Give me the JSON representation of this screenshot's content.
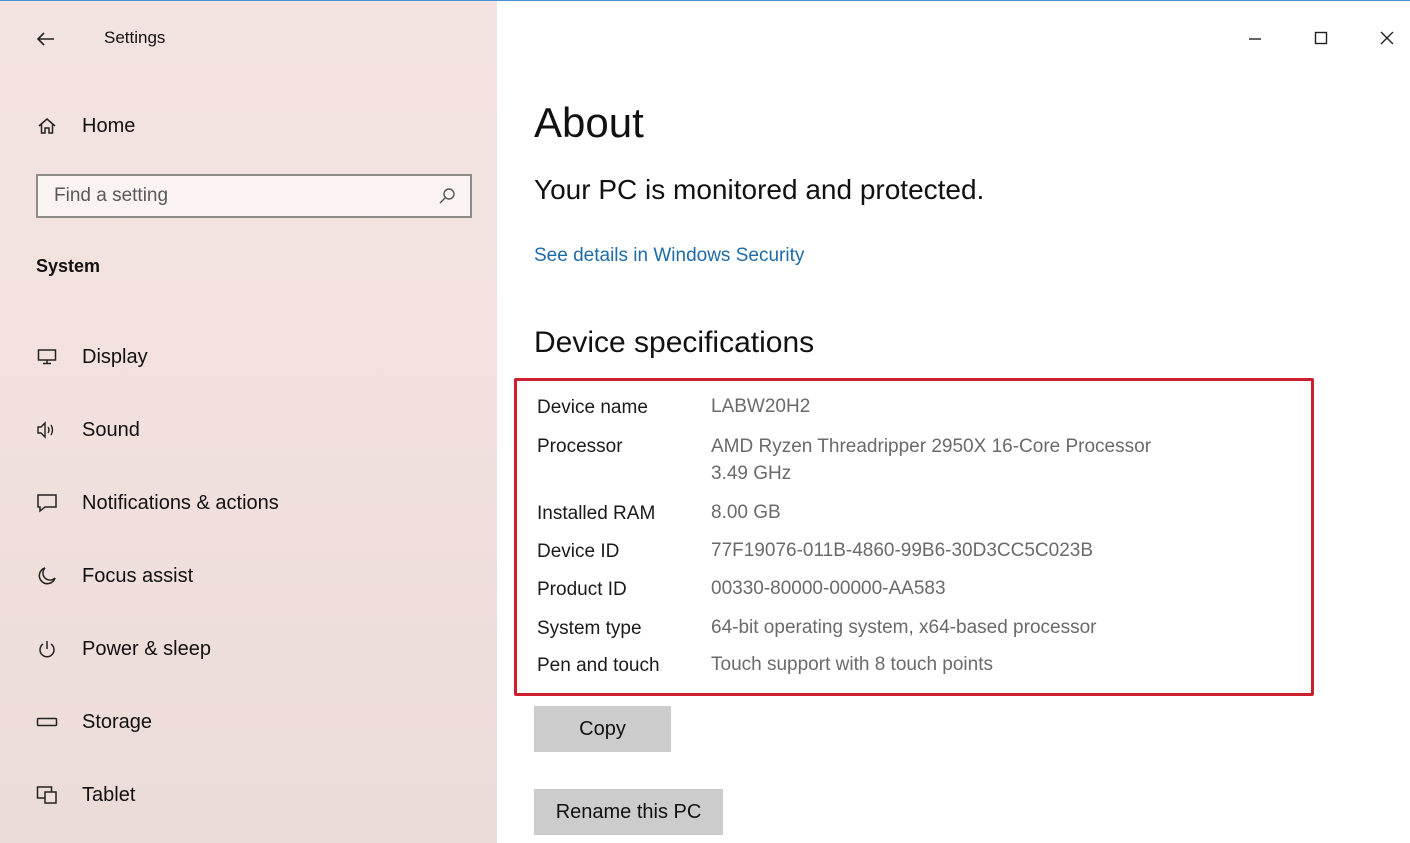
{
  "window": {
    "title": "Settings",
    "minimize_glyph": "—",
    "maximize_glyph": "☐",
    "close_glyph": "✕"
  },
  "sidebar": {
    "home_label": "Home",
    "search_placeholder": "Find a setting",
    "section_label": "System",
    "items": [
      {
        "label": "Display",
        "icon": "display-icon"
      },
      {
        "label": "Sound",
        "icon": "sound-icon"
      },
      {
        "label": "Notifications & actions",
        "icon": "notifications-icon"
      },
      {
        "label": "Focus assist",
        "icon": "focus-assist-icon"
      },
      {
        "label": "Power & sleep",
        "icon": "power-icon"
      },
      {
        "label": "Storage",
        "icon": "storage-icon"
      },
      {
        "label": "Tablet",
        "icon": "tablet-icon"
      }
    ]
  },
  "main": {
    "title": "About",
    "protection_heading": "Your PC is monitored and protected.",
    "security_link": "See details in Windows Security",
    "specs_heading": "Device specifications",
    "specs": [
      {
        "label": "Device name",
        "value": "LABW20H2"
      },
      {
        "label": "Processor",
        "value": "AMD Ryzen Threadripper 2950X 16-Core Processor",
        "value2": "3.49 GHz"
      },
      {
        "label": "Installed RAM",
        "value": "8.00 GB"
      },
      {
        "label": "Device ID",
        "value": "77F19076-011B-4860-99B6-30D3CC5C023B"
      },
      {
        "label": "Product ID",
        "value": "00330-80000-00000-AA583"
      },
      {
        "label": "System type",
        "value": "64-bit operating system, x64-based processor"
      },
      {
        "label": "Pen and touch",
        "value": "Touch support with 8 touch points"
      }
    ],
    "copy_button": "Copy",
    "rename_button": "Rename this PC"
  },
  "colors": {
    "highlight_border": "#cc1f2f",
    "link": "#1d6ca8",
    "button_bg": "#cccccc"
  }
}
